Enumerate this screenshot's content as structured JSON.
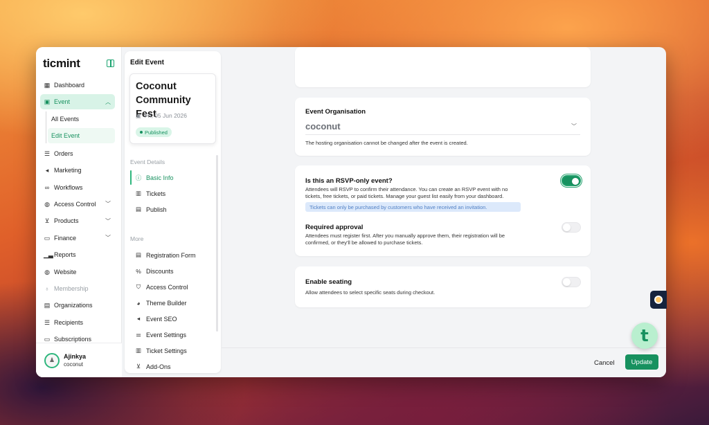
{
  "app": {
    "logo": "ticmint"
  },
  "sidebar": {
    "items": [
      {
        "label": "Dashboard",
        "icon": "dashboard-icon"
      },
      {
        "label": "Event",
        "icon": "calendar-icon",
        "expanded": true
      },
      {
        "label": "Orders",
        "icon": "list-icon"
      },
      {
        "label": "Marketing",
        "icon": "megaphone-icon"
      },
      {
        "label": "Workflows",
        "icon": "workflow-icon"
      },
      {
        "label": "Access Control",
        "icon": "globe-icon"
      },
      {
        "label": "Products",
        "icon": "cart-icon"
      },
      {
        "label": "Finance",
        "icon": "wallet-icon"
      },
      {
        "label": "Reports",
        "icon": "bar-chart-icon"
      },
      {
        "label": "Website",
        "icon": "globe-icon"
      },
      {
        "label": "Membership",
        "icon": "ribbon-icon"
      },
      {
        "label": "Organizations",
        "icon": "building-icon"
      },
      {
        "label": "Recipients",
        "icon": "list-icon"
      },
      {
        "label": "Subscriptions",
        "icon": "card-icon"
      }
    ],
    "event_sub": [
      {
        "label": "All Events"
      },
      {
        "label": "Edit Event"
      }
    ],
    "user": {
      "name": "Ajinkya",
      "org": "coconut"
    }
  },
  "edit_panel": {
    "title": "Edit Event",
    "event_name": "Coconut Community Fest",
    "event_date": "Fri, 05 Jun 2026",
    "status": "Published",
    "section_details": "Event Details",
    "section_more": "More",
    "details_items": [
      {
        "label": "Basic Info",
        "icon": "info-icon"
      },
      {
        "label": "Tickets",
        "icon": "ticket-icon"
      },
      {
        "label": "Publish",
        "icon": "document-icon"
      }
    ],
    "more_items": [
      {
        "label": "Registration Form",
        "icon": "form-icon"
      },
      {
        "label": "Discounts",
        "icon": "percent-icon"
      },
      {
        "label": "Access Control",
        "icon": "shield-icon"
      },
      {
        "label": "Theme Builder",
        "icon": "palette-icon"
      },
      {
        "label": "Event SEO",
        "icon": "megaphone-icon"
      },
      {
        "label": "Event Settings",
        "icon": "sliders-icon"
      },
      {
        "label": "Ticket Settings",
        "icon": "ticket-settings-icon"
      },
      {
        "label": "Add-Ons",
        "icon": "cart-icon"
      }
    ]
  },
  "main": {
    "organisation": {
      "title": "Event Organisation",
      "value": "coconut",
      "note": "The hosting organisation cannot be changed after the event is created."
    },
    "rsvp": {
      "title": "Is this an RSVP-only event?",
      "description": "Attendees will RSVP to confirm their attendance. You can create an RSVP event with no tickets, free tickets, or paid tickets. Manage your guest list easily from your dashboard.",
      "info": "Tickets can only be purchased by customers who have received an invitation.",
      "enabled": true
    },
    "approval": {
      "title": "Required approval",
      "description": "Attendees must register first. After you manually approve them, their registration will be confirmed, or they'll be allowed to purchase tickets.",
      "enabled": false
    },
    "seating": {
      "title": "Enable seating",
      "description": "Allow attendees to select specific seats during checkout.",
      "enabled": false
    }
  },
  "footer": {
    "cancel_label": "Cancel",
    "update_label": "Update"
  },
  "colors": {
    "accent": "#17915f",
    "accent_light": "#d8f3e7",
    "info_bg": "#dce9fb",
    "info_text": "#4f7fc4"
  }
}
